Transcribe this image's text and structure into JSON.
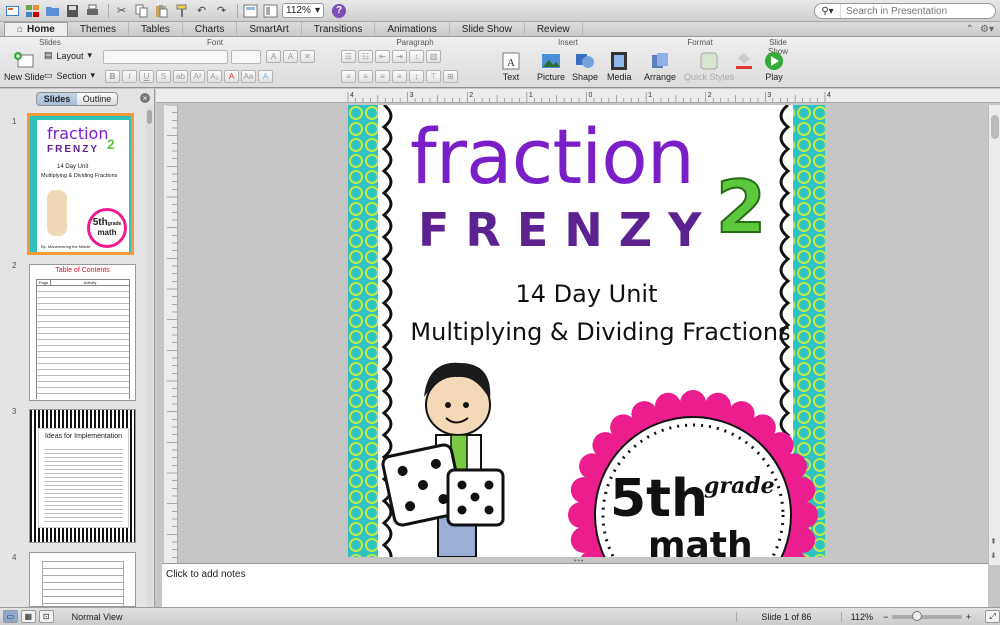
{
  "toolbar": {
    "zoom": "112%",
    "help_label": "?",
    "search_placeholder": "Search in Presentation"
  },
  "ribbon_tabs": [
    {
      "label": "Home",
      "active": true
    },
    {
      "label": "Themes"
    },
    {
      "label": "Tables"
    },
    {
      "label": "Charts"
    },
    {
      "label": "SmartArt"
    },
    {
      "label": "Transitions"
    },
    {
      "label": "Animations"
    },
    {
      "label": "Slide Show"
    },
    {
      "label": "Review"
    }
  ],
  "ribbon": {
    "groups": {
      "slides": "Slides",
      "font": "Font",
      "paragraph": "Paragraph",
      "insert": "Insert",
      "format": "Format",
      "slide_show": "Slide Show"
    },
    "new_slide": "New Slide",
    "layout": "Layout",
    "section": "Section",
    "text": "Text",
    "picture": "Picture",
    "shape": "Shape",
    "media": "Media",
    "arrange": "Arrange",
    "quick_styles": "Quick Styles",
    "play": "Play"
  },
  "left_pane": {
    "tab_slides": "Slides",
    "tab_outline": "Outline",
    "thumbnails": [
      {
        "number": "1",
        "title": "fraction",
        "title2": "FRENZY",
        "line1": "14 Day Unit",
        "line2": "Multiplying & Dividing Fractions",
        "badge_big": "5th",
        "badge_small": "grade",
        "badge_math": "math",
        "credit": "By: Maneuvering the Middle"
      },
      {
        "number": "2",
        "title": "Table of Contents",
        "header_page": "Page",
        "header_activity": "Activity"
      },
      {
        "number": "3",
        "title": "Ideas for Implementation"
      },
      {
        "number": "4"
      }
    ]
  },
  "slide": {
    "title_line1": "fraction",
    "title_line2": "FRENZY",
    "title_number": "2",
    "subtitle1": "14 Day Unit",
    "subtitle2": "Multiplying & Dividing Fractions",
    "badge_big": "5th",
    "badge_small": "grade",
    "badge_math": "math"
  },
  "ruler_marks": [
    "4",
    "3",
    "2",
    "1",
    "0",
    "1",
    "2",
    "3",
    "4"
  ],
  "notes_placeholder": "Click to add notes",
  "status": {
    "view": "Normal View",
    "slide_counter": "Slide 1 of 86",
    "zoom": "112%"
  },
  "colors": {
    "turquoise": "#2dc3c0",
    "lime": "#c2e84b",
    "purple": "#7a1fc7",
    "green_two": "#5cc83b",
    "pink": "#ec1d8e"
  }
}
